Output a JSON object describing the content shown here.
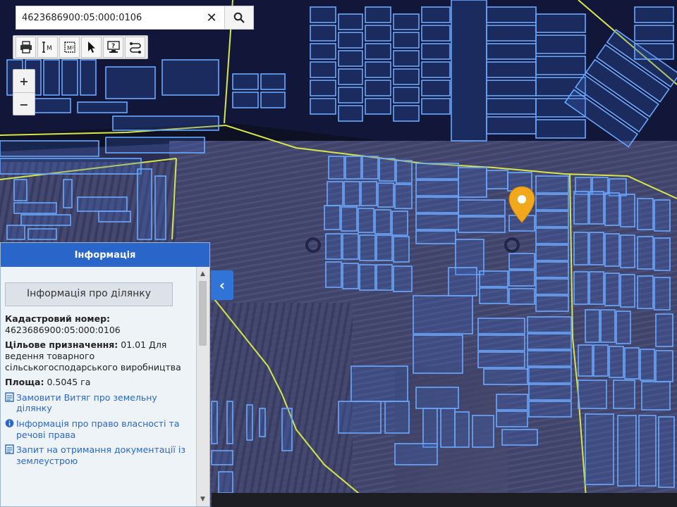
{
  "search": {
    "value": "4623686900:05:000:0106",
    "clear_icon": "close-icon",
    "search_icon": "magnifier-icon"
  },
  "toolbar": {
    "tools": [
      "print-icon",
      "measure-length-icon",
      "measure-area-icon",
      "pointer-icon",
      "info-icon",
      "route-icon"
    ]
  },
  "zoom": {
    "in_label": "+",
    "out_label": "−"
  },
  "panel": {
    "title": "Інформація",
    "section_title": "Інформація про ділянку",
    "cadastral_label": "Кадастровий номер:",
    "cadastral_value": "4623686900:05:000:0106",
    "purpose_label": "Цільове призначення:",
    "purpose_value": "01.01 Для ведення товарного сільськогосподарського виробництва",
    "area_label": "Площа:",
    "area_value": "0.5045 га",
    "links": [
      "Замовити Витяг про земельну ділянку",
      "Інформація про право власності та речові права",
      "Запит на отримання документації із землеустрою"
    ],
    "collapse_icon": "chevron-left-icon"
  },
  "colors": {
    "parcel": "#6aa8ff",
    "boundary": "#d6e64a",
    "marker": "#f2a81d",
    "panel_header": "#2a66c9",
    "link": "#2a66c9"
  }
}
